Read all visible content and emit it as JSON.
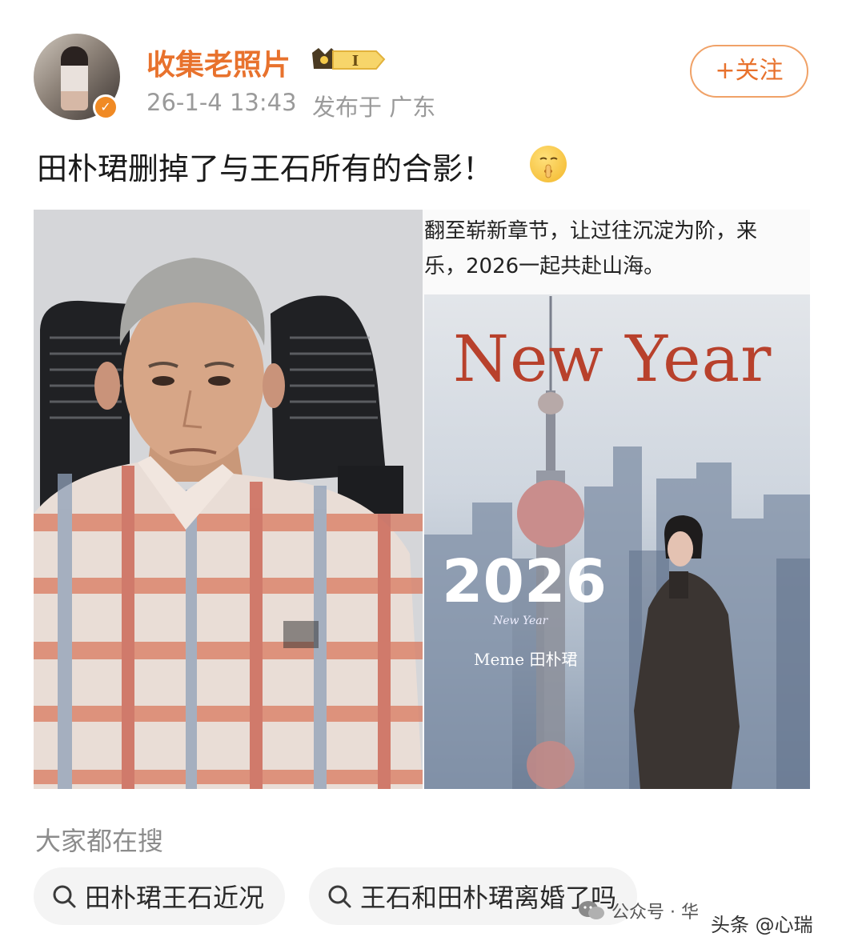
{
  "header": {
    "username": "收集老照片",
    "vip_level": "I",
    "post_time": "26-1-4 13:43",
    "post_location": "发布于 广东",
    "follow_label": "+关注"
  },
  "post": {
    "text": "田朴珺删掉了与王石所有的合影！",
    "emoji": "shushing-face-icon"
  },
  "images": {
    "right": {
      "caption_line1": "翻至崭新章节，让过往沉淀为阶，来",
      "caption_line2": "乐，2026一起共赴山海。",
      "poster_title": "New Year",
      "poster_year": "2026",
      "poster_script": "New Year",
      "poster_author": "Meme 田朴珺"
    }
  },
  "search": {
    "heading": "大家都在搜",
    "chips": [
      {
        "label": "田朴珺王石近况"
      },
      {
        "label": "王石和田朴珺离婚了吗"
      }
    ]
  },
  "watermarks": {
    "gzh": "公众号 · 华",
    "toutiao": "头条 @心瑞"
  },
  "colors": {
    "accent": "#e8722d",
    "poster_red": "#b8412c"
  }
}
